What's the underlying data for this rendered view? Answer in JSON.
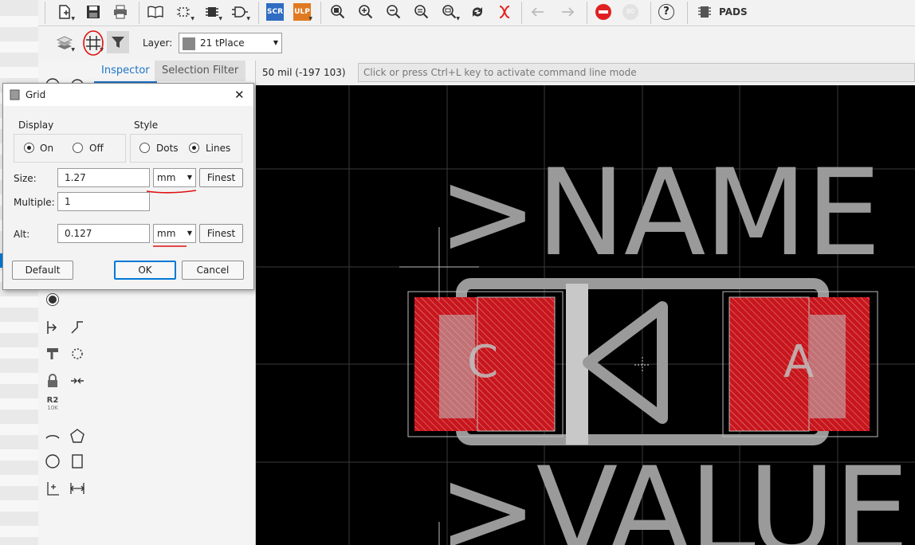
{
  "toolbar": {
    "scr_label": "SCR",
    "ulp_label": "ULP",
    "pads_label": "PADS",
    "circle_badge": "80",
    "help_label": "?"
  },
  "toolbar2": {
    "layer_label": "Layer:",
    "layer_value": "21 tPlace"
  },
  "inspector": {
    "tabs": [
      "Inspector",
      "Selection Filter"
    ]
  },
  "status": {
    "grid_readout": "50 mil (-197 103)",
    "command_placeholder": "Click or press Ctrl+L key to activate command line mode"
  },
  "canvas": {
    "name_text": ">NAME",
    "value_text": ">VALUE",
    "pad_c": "C",
    "pad_a": "A"
  },
  "palette": {
    "r2_label": "R2",
    "r2_sub": "10K"
  },
  "dialog": {
    "title": "Grid",
    "display_label": "Display",
    "display_on": "On",
    "display_off": "Off",
    "style_label": "Style",
    "style_dots": "Dots",
    "style_lines": "Lines",
    "size_label": "Size:",
    "size_value": "1.27",
    "size_unit": "mm",
    "finest_label": "Finest",
    "multiple_label": "Multiple:",
    "multiple_value": "1",
    "alt_label": "Alt:",
    "alt_value": "0.127",
    "alt_unit": "mm",
    "default_label": "Default",
    "ok_label": "OK",
    "cancel_label": "Cancel",
    "close_glyph": "✕"
  },
  "colors": {
    "accent": "#0078d7",
    "pad_red": "#c8161d",
    "silk_gray": "#9a9a9a",
    "annotation_red": "#e01010"
  }
}
